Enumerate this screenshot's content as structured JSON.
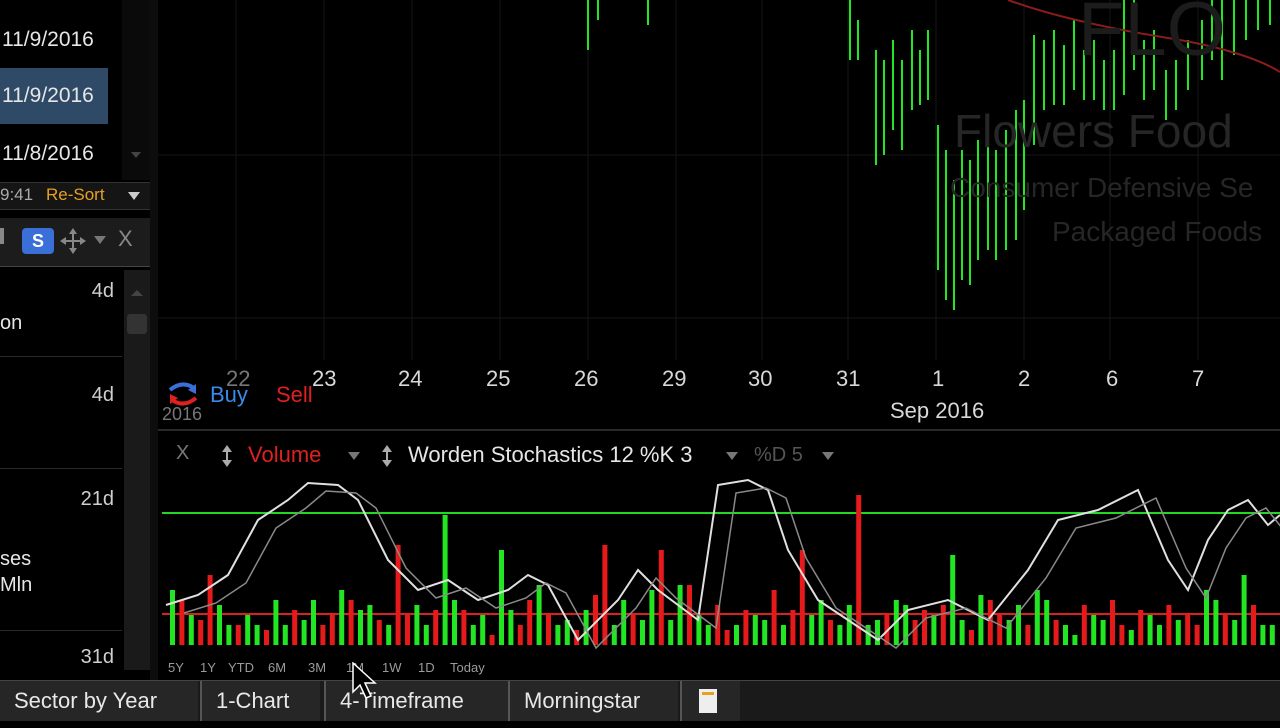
{
  "watchlist": {
    "rows": [
      {
        "date": "11/9/2016",
        "selected": false
      },
      {
        "date": "11/9/2016",
        "selected": true
      },
      {
        "date": "11/8/2016",
        "selected": false
      }
    ],
    "time_fragment": "9:41",
    "resort_label": "Re-Sort",
    "s_badge": "S",
    "close_x": "X",
    "items": [
      {
        "age": "4d",
        "text": "on"
      },
      {
        "age": "4d",
        "text": ""
      },
      {
        "age": "21d",
        "text": "ses\nMln"
      },
      {
        "age": "31d",
        "text": ""
      }
    ]
  },
  "chart": {
    "company": "Flowers Food",
    "symbol": "FLO",
    "sector": "Consumer Defensive Se",
    "industry": "Packaged Foods",
    "x_labels": [
      "23",
      "24",
      "25",
      "26",
      "29",
      "30",
      "31",
      "1",
      "2",
      "6",
      "7"
    ],
    "x_label_partial": "22",
    "month_label": "Sep 2016",
    "year_fragment": "2016",
    "buy_label": "Buy",
    "sell_label": "Sell"
  },
  "indicator_bar": {
    "close": "X",
    "volume": "Volume",
    "stochastics": "Worden Stochastics 12 %K 3",
    "d": "%D 5"
  },
  "timeframes": [
    "5Y",
    "1Y",
    "YTD",
    "6M",
    "3M",
    "1M",
    "1W",
    "1D",
    "Today"
  ],
  "tabs": [
    "Sector by Year",
    "1-Chart",
    "4-Timeframe",
    "Morningstar"
  ],
  "colors": {
    "up": "#22e622",
    "down": "#e61a1a",
    "selection": "#2e4a66",
    "resort": "#e8a020",
    "badge": "#3a6fd8"
  }
}
